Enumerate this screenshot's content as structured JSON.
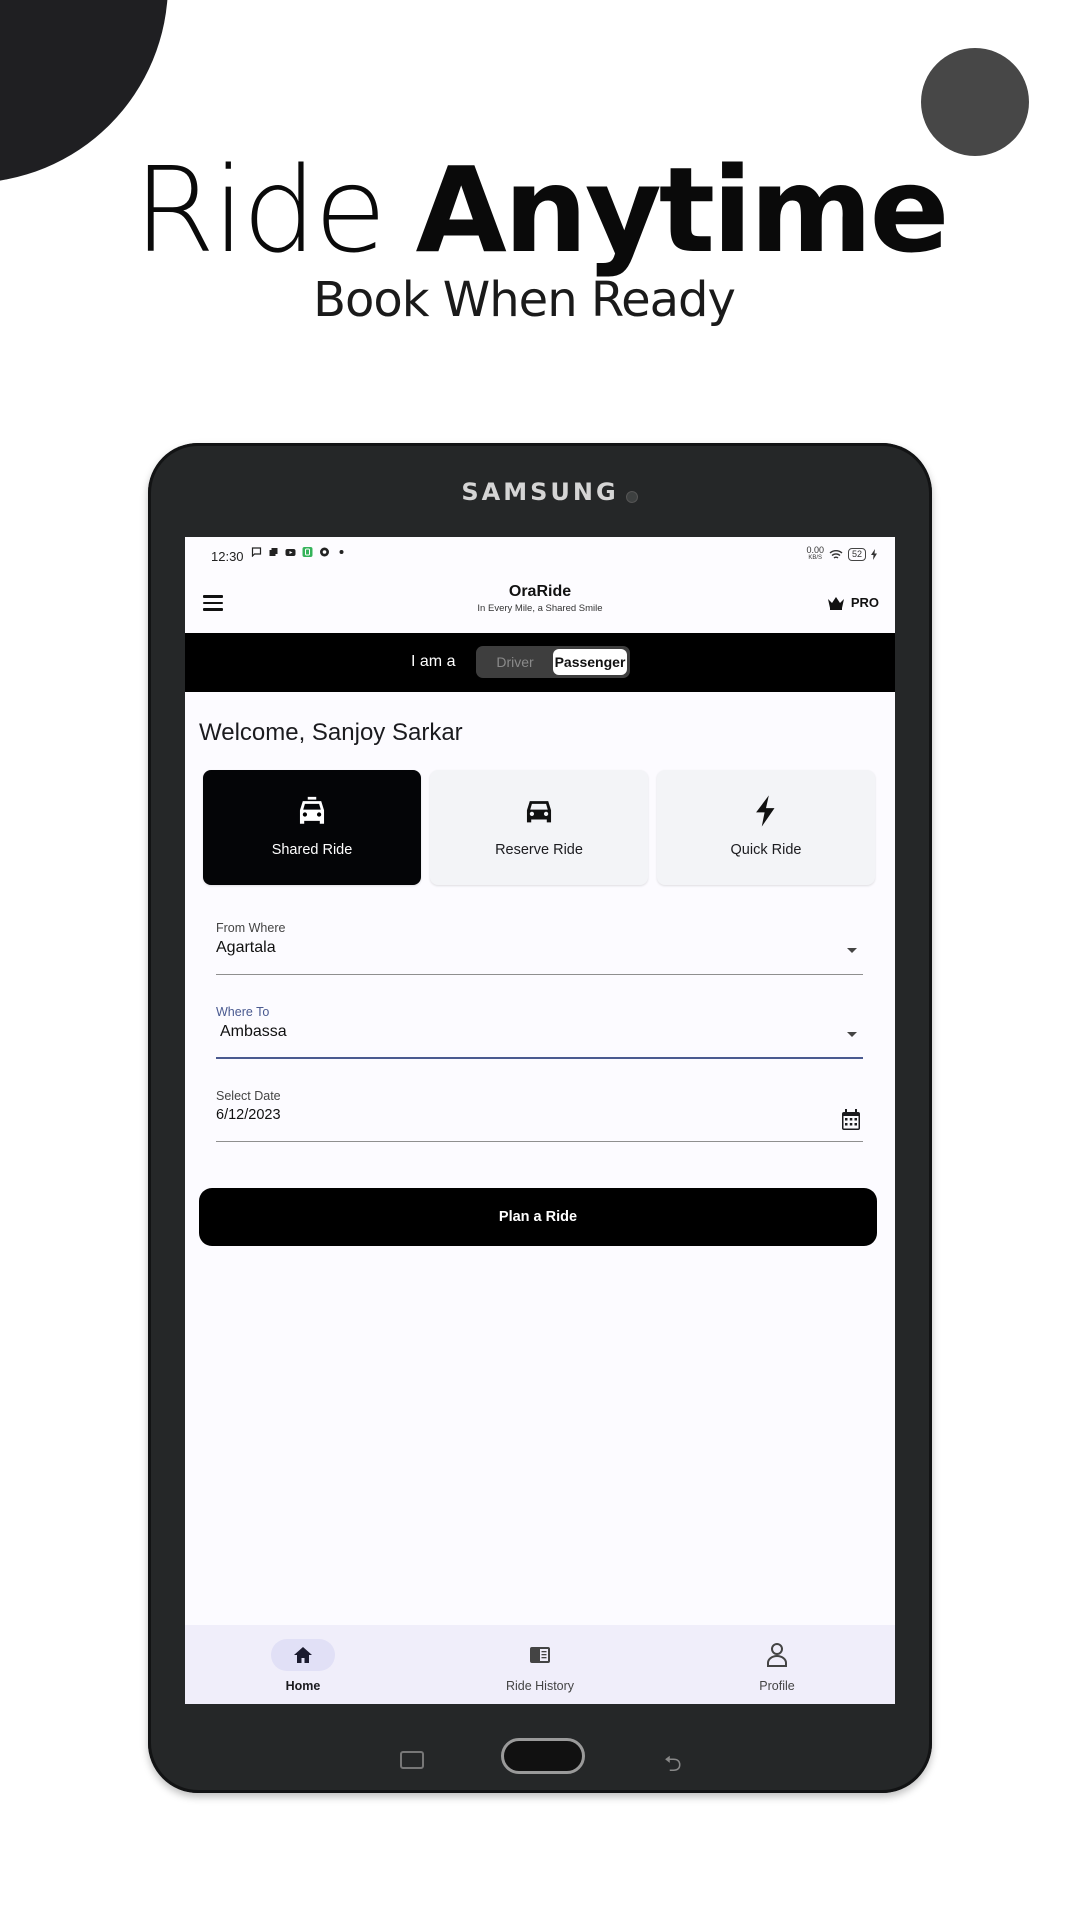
{
  "promo": {
    "headline_light": "Ride",
    "headline_bold": "Anytime",
    "subline": "Book When Ready"
  },
  "device": {
    "brand": "SAMSUNG"
  },
  "statusbar": {
    "time": "12:30",
    "net_speed": "0.00",
    "net_unit": "KB/S",
    "battery": "52"
  },
  "appbar": {
    "title": "OraRide",
    "subtitle": "In Every Mile, a Shared Smile",
    "pro_label": "PRO"
  },
  "role": {
    "label": "I am a",
    "options": [
      "Driver",
      "Passenger"
    ],
    "selected": "Passenger"
  },
  "welcome": "Welcome, Sanjoy Sarkar",
  "ride_types": [
    {
      "label": "Shared Ride",
      "icon": "taxi-icon",
      "active": true
    },
    {
      "label": "Reserve Ride",
      "icon": "car-icon",
      "active": false
    },
    {
      "label": "Quick Ride",
      "icon": "bolt-icon",
      "active": false
    }
  ],
  "form": {
    "from": {
      "label": "From Where",
      "value": "Agartala"
    },
    "to": {
      "label": "Where To",
      "value": "Ambassa"
    },
    "date": {
      "label": "Select Date",
      "value": "6/12/2023"
    }
  },
  "plan_button": "Plan a Ride",
  "bottom_nav": [
    {
      "label": "Home",
      "icon": "home-icon",
      "active": true
    },
    {
      "label": "Ride History",
      "icon": "history-icon",
      "active": false
    },
    {
      "label": "Profile",
      "icon": "person-icon",
      "active": false
    }
  ],
  "colors": {
    "accent": "#4a5a90",
    "primary": "#000000",
    "nav_bg": "#f0eefa"
  }
}
